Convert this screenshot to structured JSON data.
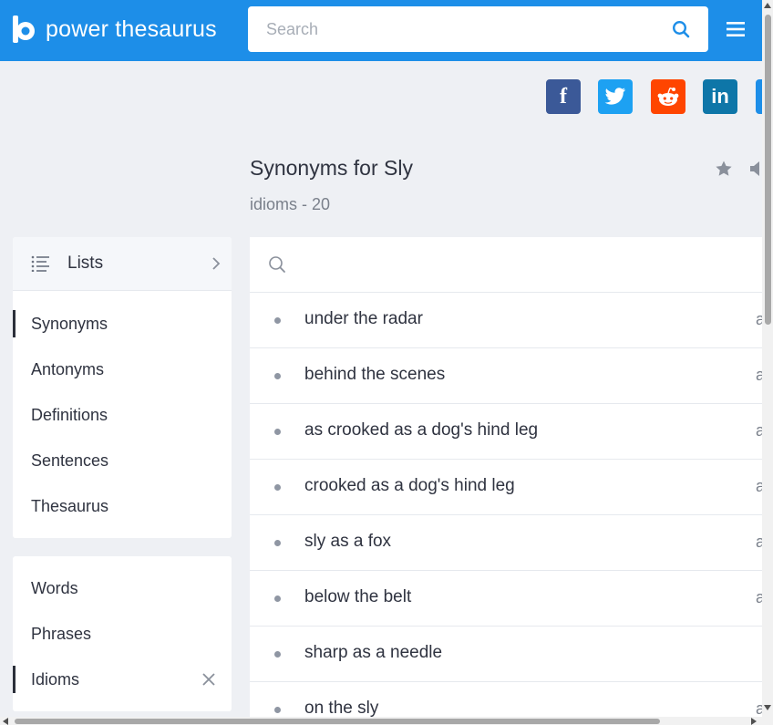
{
  "header": {
    "brand": "power thesaurus",
    "search_placeholder": "Search",
    "brand_color": "#1d8ee8"
  },
  "share_icons": [
    "facebook-icon",
    "twitter-icon",
    "reddit-icon",
    "linkedin-icon",
    "share-more-icon"
  ],
  "share_labels": {
    "facebook": "f",
    "linkedin": "in"
  },
  "page": {
    "title": "Synonyms for Sly",
    "subtitle": "idioms - 20"
  },
  "sidebar": {
    "lists_label": "Lists",
    "items": [
      {
        "label": "Synonyms",
        "active": true
      },
      {
        "label": "Antonyms",
        "active": false
      },
      {
        "label": "Definitions",
        "active": false
      },
      {
        "label": "Sentences",
        "active": false
      },
      {
        "label": "Thesaurus",
        "active": false
      }
    ],
    "types": [
      {
        "label": "Words",
        "active": false
      },
      {
        "label": "Phrases",
        "active": false
      },
      {
        "label": "Idioms",
        "active": true
      }
    ]
  },
  "results": [
    {
      "term": "under the radar",
      "trail": "a"
    },
    {
      "term": "behind the scenes",
      "trail": "a"
    },
    {
      "term": "as crooked as a dog's hind leg",
      "trail": "a"
    },
    {
      "term": "crooked as a dog's hind leg",
      "trail": "a"
    },
    {
      "term": "sly as a fox",
      "trail": "a"
    },
    {
      "term": "below the belt",
      "trail": "a"
    },
    {
      "term": "sharp as a needle",
      "trail": ""
    },
    {
      "term": "on the sly",
      "trail": "a"
    }
  ]
}
